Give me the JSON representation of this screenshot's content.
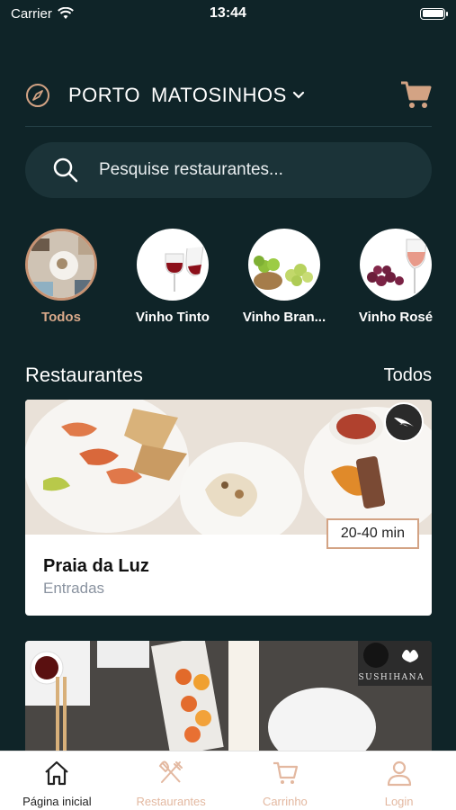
{
  "status": {
    "carrier": "Carrier",
    "time": "13:44"
  },
  "header": {
    "city": "PORTO",
    "area": "MATOSINHOS",
    "icons": [
      "compass-icon",
      "chevron-down-icon",
      "cart-icon"
    ]
  },
  "search": {
    "placeholder": "Pesquise restaurantes..."
  },
  "categories": [
    {
      "label": "Todos",
      "active": true
    },
    {
      "label": "Vinho Tinto",
      "active": false
    },
    {
      "label": "Vinho Bran...",
      "active": false
    },
    {
      "label": "Vinho Rosé",
      "active": false
    }
  ],
  "restaurants": {
    "title": "Restaurantes",
    "link": "Todos",
    "items": [
      {
        "name": "Praia da Luz",
        "category": "Entradas",
        "eta": "20-40 min"
      },
      {
        "brand": "SUSHIHANA"
      }
    ]
  },
  "tabbar": {
    "items": [
      {
        "label": "Página inicial",
        "icon": "home-icon",
        "active": true
      },
      {
        "label": "Restaurantes",
        "icon": "utensils-icon",
        "active": false
      },
      {
        "label": "Carrinho",
        "icon": "cart-icon",
        "active": false
      },
      {
        "label": "Login",
        "icon": "user-icon",
        "active": false
      }
    ]
  },
  "colors": {
    "background": "#0f2428",
    "accent": "#d3a384",
    "search_bg": "#1b3338"
  }
}
